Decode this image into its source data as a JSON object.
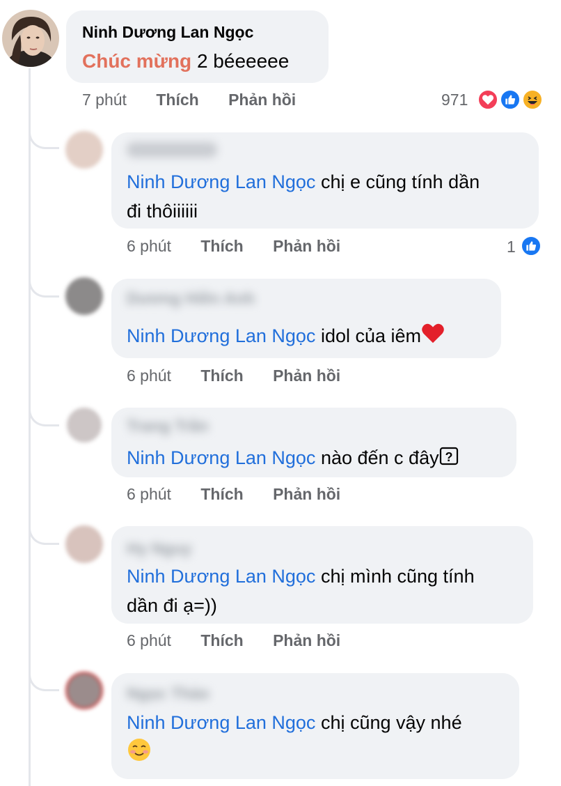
{
  "main_comment": {
    "author": "Ninh Dương Lan Ngọc",
    "text_highlight": "Chúc mừng",
    "text_rest": "2 béeeeee",
    "time": "7 phút",
    "like": "Thích",
    "reply": "Phản hồi",
    "reaction_count": "971",
    "reactions": [
      "love-icon",
      "like-icon",
      "haha-icon"
    ]
  },
  "replies": [
    {
      "author": "",
      "mention": "Ninh Dương Lan Ngọc",
      "line1": "chị e cũng tính dần",
      "line2": "đi thôiiiiii",
      "time": "6 phút",
      "like": "Thích",
      "reply": "Phản hồi",
      "reaction_count": "1"
    },
    {
      "author": "Dương Hiền Anh",
      "mention": "Ninh Dương Lan Ngọc",
      "line1": "idol của iêm",
      "time": "6 phút",
      "like": "Thích",
      "reply": "Phản hồi"
    },
    {
      "author": "Trang Trần",
      "mention": "Ninh Dương Lan Ngọc",
      "line1": "nào đến c đây",
      "time": "6 phút",
      "like": "Thích",
      "reply": "Phản hồi"
    },
    {
      "author": "Hy Nguy",
      "mention": "Ninh Dương Lan Ngọc",
      "line1": "chị mình cũng tính",
      "line2": "dần đi ạ=))",
      "time": "6 phút",
      "like": "Thích",
      "reply": "Phản hồi"
    },
    {
      "author": "Ngọc Thảo",
      "mention": "Ninh Dương Lan Ngọc",
      "line1": "chị cũng vậy nhé",
      "time": "",
      "like": "",
      "reply": ""
    }
  ],
  "colors": {
    "mention": "#216fdb",
    "highlight": "#e2715c",
    "bubble": "#f0f2f5",
    "meta": "#65676b"
  }
}
